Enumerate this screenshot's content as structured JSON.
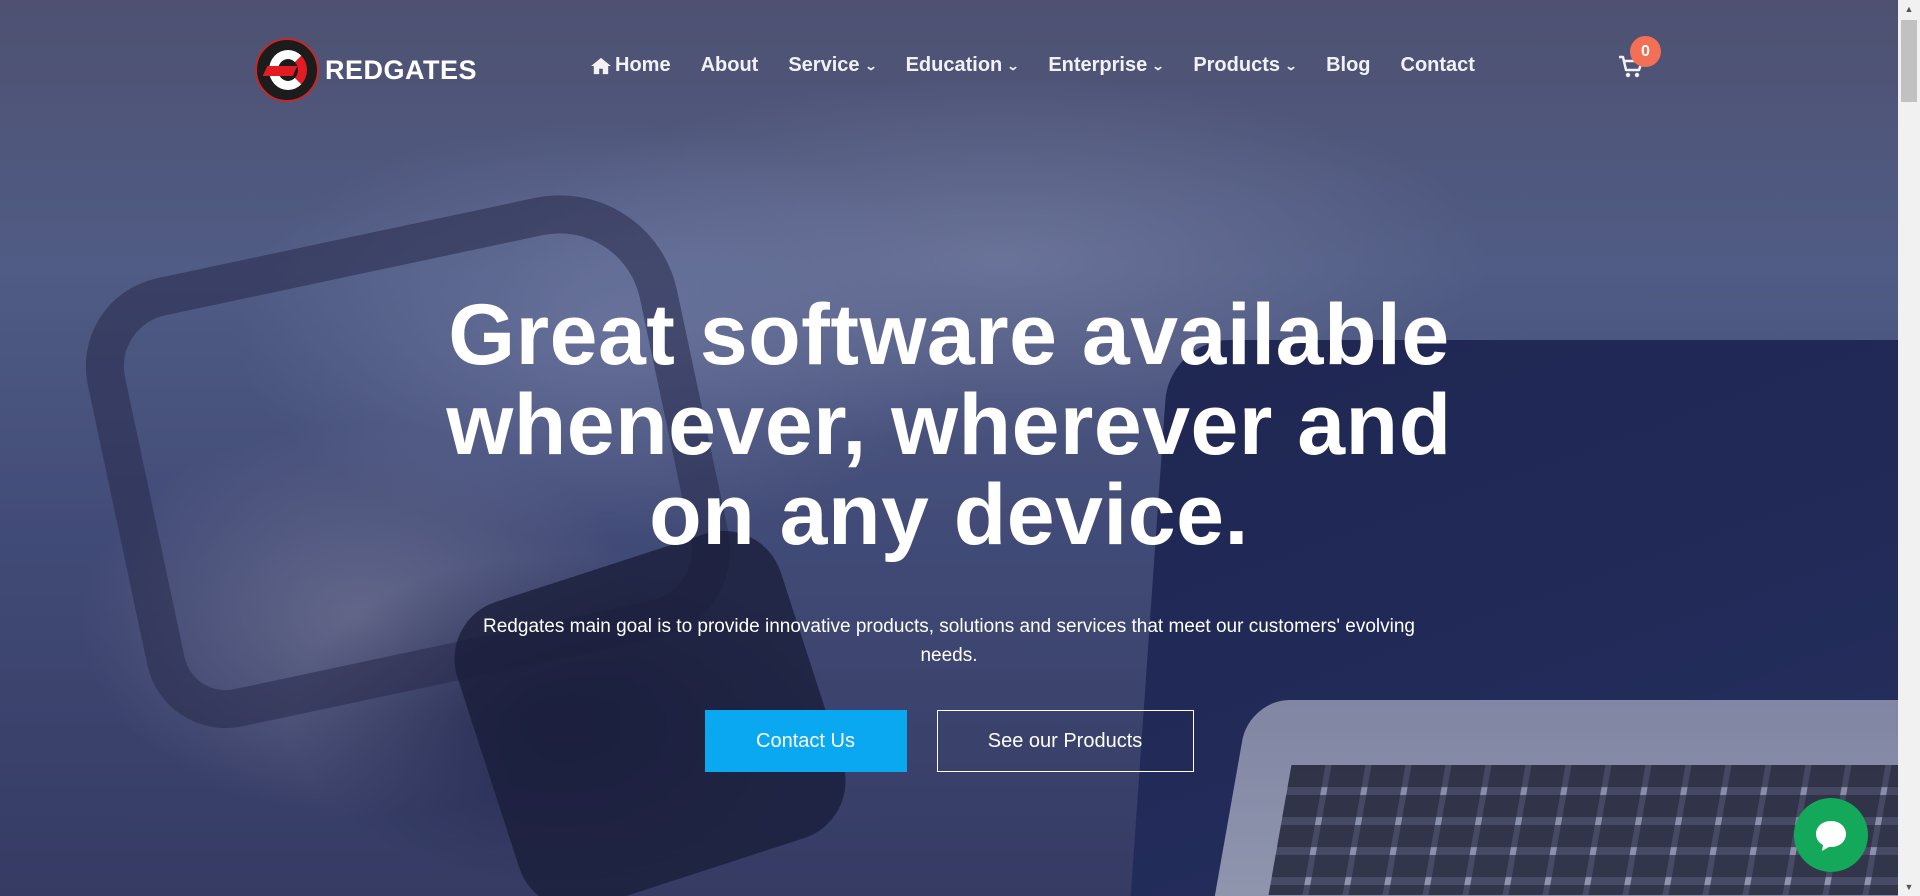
{
  "brand": {
    "name": "REDGATES",
    "logo_icon": "redgates-r-logo"
  },
  "nav": {
    "items": [
      {
        "label": "Home",
        "icon": "home-icon",
        "has_dropdown": false
      },
      {
        "label": "About",
        "has_dropdown": false
      },
      {
        "label": "Service",
        "has_dropdown": true
      },
      {
        "label": "Education",
        "has_dropdown": true
      },
      {
        "label": "Enterprise",
        "has_dropdown": true
      },
      {
        "label": "Products",
        "has_dropdown": true
      },
      {
        "label": "Blog",
        "has_dropdown": false
      },
      {
        "label": "Contact",
        "has_dropdown": false
      }
    ]
  },
  "cart": {
    "count": "0",
    "icon": "cart-icon"
  },
  "hero": {
    "title": "Great software available whenever, wherever and on any device.",
    "subtitle": "Redgates main goal is to provide innovative products, solutions and services that meet our customers' evolving needs.",
    "primary_button": "Contact Us",
    "secondary_button": "See our Products"
  },
  "chat": {
    "icon": "chat-bubble-icon"
  },
  "colors": {
    "primary_button": "#0aa8f0",
    "cart_badge": "#f36f56",
    "chat_button": "#14a85a",
    "brand_red": "#e31b23"
  }
}
